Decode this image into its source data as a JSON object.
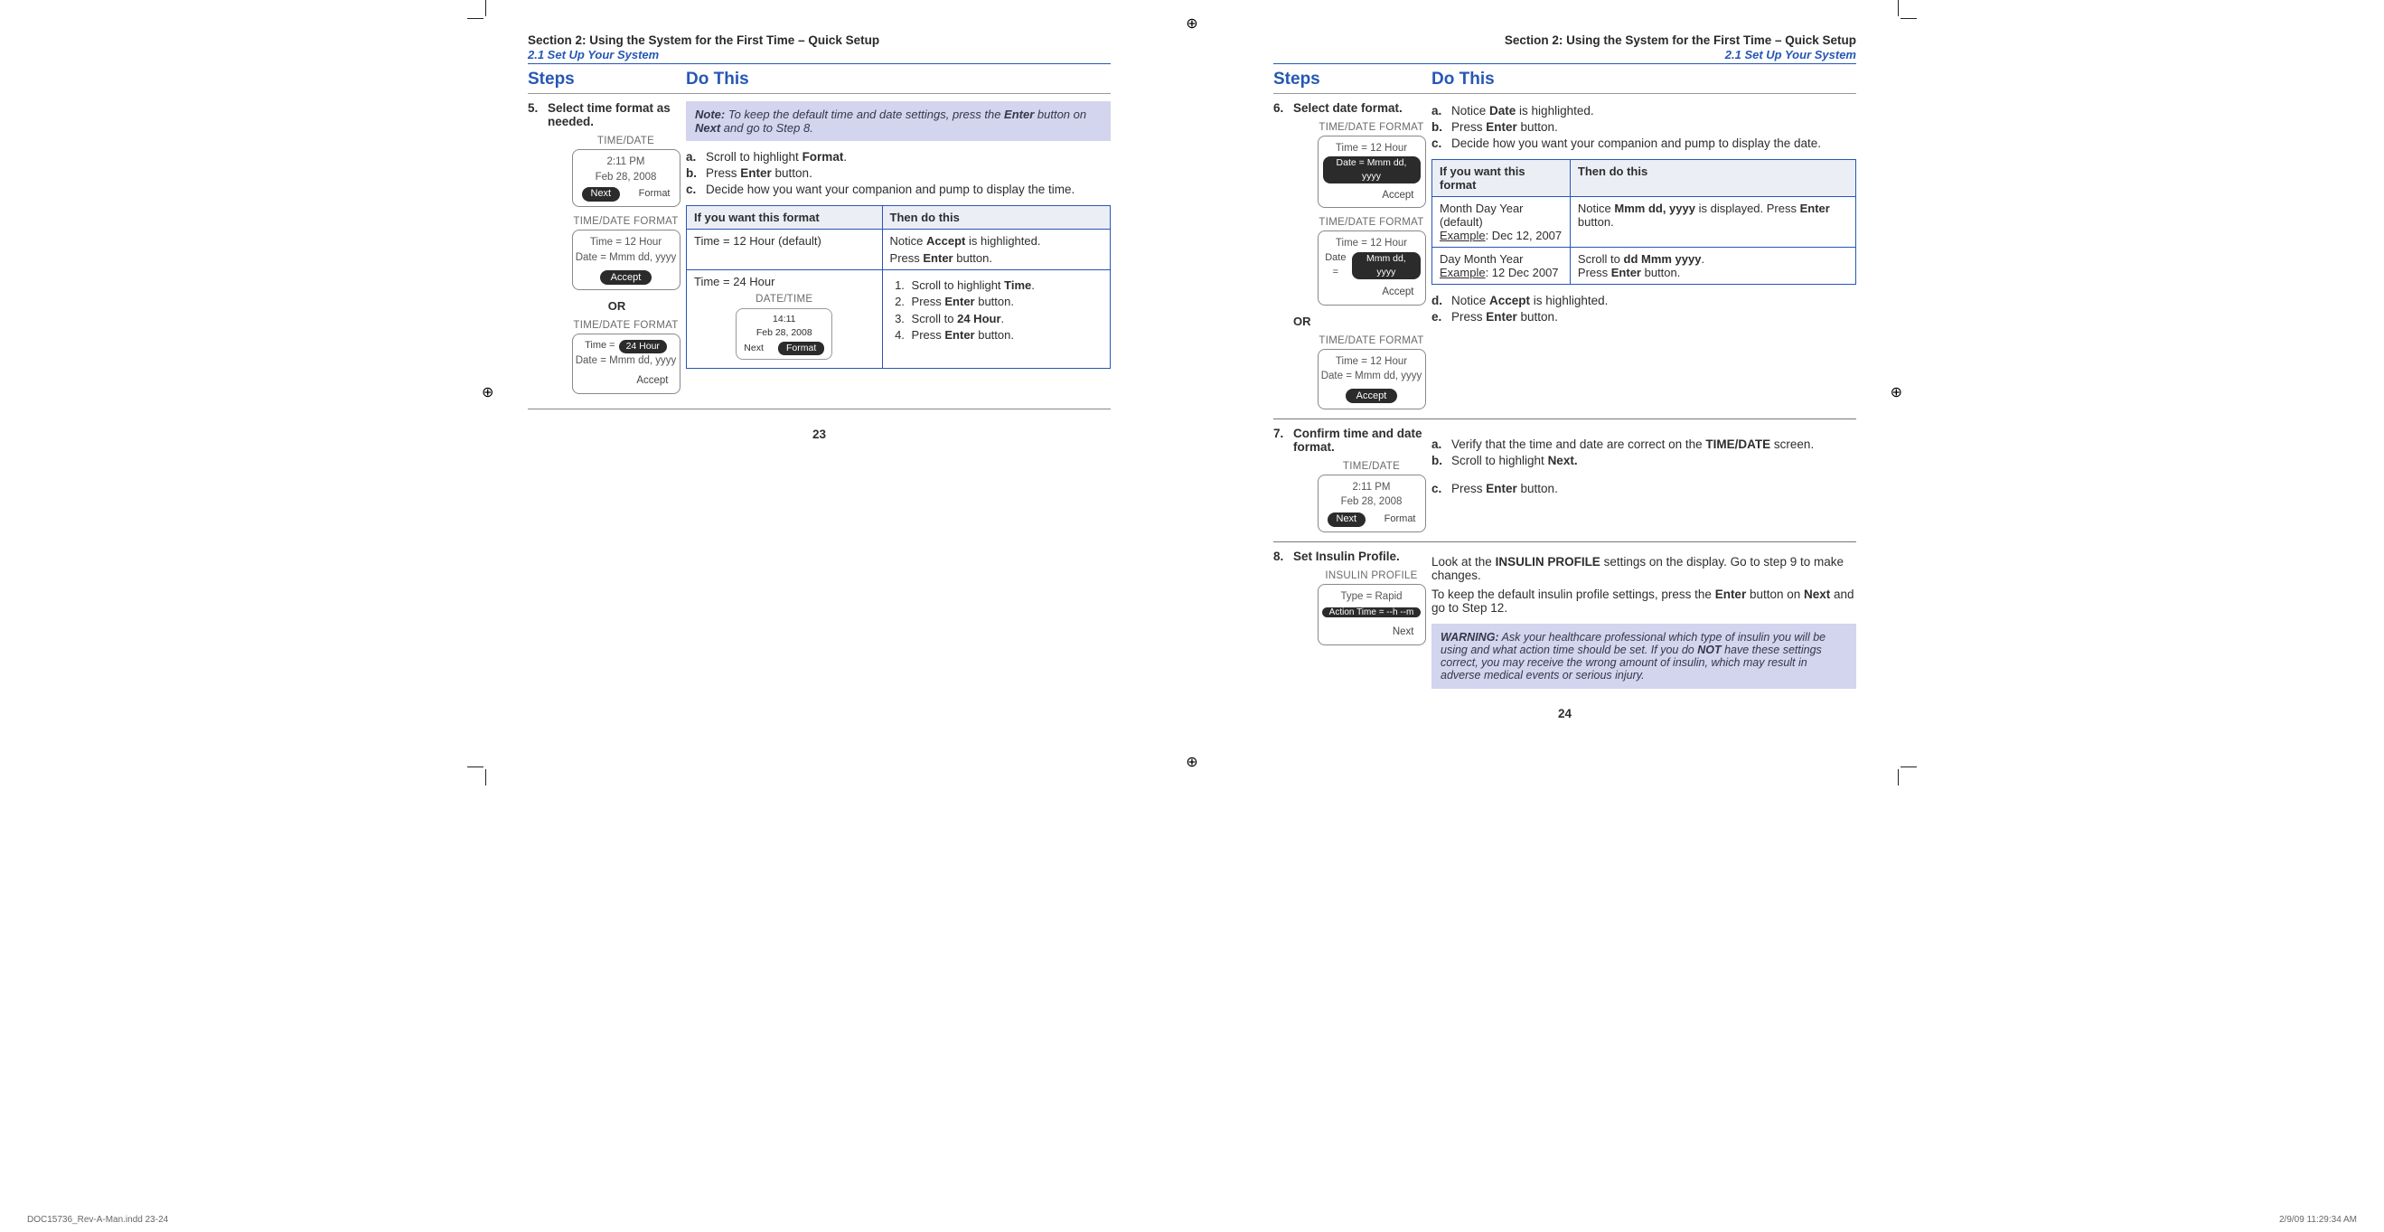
{
  "section_header": "Section 2: Using the System for the First Time – Quick Setup",
  "section_sub": "2.1 Set Up Your System",
  "col_steps": "Steps",
  "col_do": "Do This",
  "or": "OR",
  "pages": {
    "left": "23",
    "right": "24"
  },
  "footer": {
    "left": "DOC15736_Rev-A-Man.indd   23-24",
    "right": "2/9/09   11:29:34 AM"
  },
  "left": {
    "step5": {
      "num": "5.",
      "title": "Select time format as needed.",
      "screen1": {
        "title": "TIME/DATE",
        "line1": "2:11 PM",
        "line2": "Feb 28, 2008",
        "btn_sel": "Next",
        "btn": "Format"
      },
      "screen2": {
        "title": "TIME/DATE FORMAT",
        "line1": "Time = 12 Hour",
        "line2": "Date = Mmm dd, yyyy",
        "accept": "Accept"
      },
      "screen3": {
        "title": "TIME/DATE FORMAT",
        "time_lhs": "Time =",
        "time_pill": "24 Hour",
        "line2": "Date = Mmm dd, yyyy",
        "accept": "Accept"
      },
      "note": {
        "label": "Note:",
        "t1": " To keep the default time and date settings, press the ",
        "b1": "Enter",
        "t2": " button on ",
        "b2": "Next",
        "t3": " and go to Step 8."
      },
      "a": {
        "lt": "a.",
        "t1": "Scroll to highlight ",
        "b": "Format",
        "t2": "."
      },
      "b": {
        "lt": "b.",
        "t1": "Press ",
        "bold": "Enter",
        "t2": " button."
      },
      "c": {
        "lt": "c.",
        "txt": "Decide how you want your companion and pump to display the time."
      },
      "table": {
        "h1": "If you want this format",
        "h2": "Then do this",
        "r1c1": "Time = 12 Hour (default)",
        "r1c2a": "Notice ",
        "r1c2b": "Accept",
        "r1c2c": " is highlighted.",
        "r1c2d": "Press ",
        "r1c2e": "Enter",
        "r1c2f": " button.",
        "r2c1": "Time = 24 Hour",
        "dt_title": "DATE/TIME",
        "dt_line1": "14:11",
        "dt_line2": "Feb 28, 2008",
        "dt_next": "Next",
        "dt_format": "Format",
        "li1a": "Scroll to highlight ",
        "li1b": "Time",
        "li1c": ".",
        "li2a": "Press ",
        "li2b": "Enter",
        "li2c": " button.",
        "li3a": "Scroll to ",
        "li3b": "24 Hour",
        "li3c": ".",
        "li4a": "Press ",
        "li4b": "Enter",
        "li4c": " button."
      }
    }
  },
  "right": {
    "step6": {
      "num": "6.",
      "title": "Select date format.",
      "screen1": {
        "title": "TIME/DATE FORMAT",
        "line1": "Time = 12 Hour",
        "date_lhs": "Date =",
        "date_pill": "Mmm dd, yyyy",
        "accept": "Accept"
      },
      "screen2": {
        "title": "TIME/DATE FORMAT",
        "line1": "Time = 12 Hour",
        "date_lhs": "Date =",
        "date_pill": "Mmm dd, yyyy",
        "accept": "Accept"
      },
      "screen3": {
        "title": "TIME/DATE FORMAT",
        "line1": "Time = 12 Hour",
        "line2": "Date = Mmm dd, yyyy",
        "accept": "Accept"
      },
      "a": {
        "lt": "a.",
        "t1": "Notice ",
        "b": "Date",
        "t2": " is highlighted."
      },
      "b": {
        "lt": "b.",
        "t1": "Press ",
        "b": "Enter",
        "t2": " button."
      },
      "c": {
        "lt": "c.",
        "txt": "Decide how you want your companion and pump to display the date."
      },
      "table": {
        "h1": "If you want this format",
        "h2": "Then do this",
        "r1c1a": "Month Day Year (default)",
        "r1c1b": "Example",
        "r1c1c": ": Dec 12, 2007",
        "r1c2a": "Notice ",
        "r1c2b": "Mmm dd, yyyy",
        "r1c2c": " is displayed. Press ",
        "r1c2d": "Enter",
        "r1c2e": " button.",
        "r2c1a": "Day Month Year",
        "r2c1b": "Example",
        "r2c1c": ": 12 Dec 2007",
        "r2c2a": "Scroll to ",
        "r2c2b": "dd Mmm yyyy",
        "r2c2c": ". ",
        "r2c2d": "Press ",
        "r2c2e": "Enter",
        "r2c2f": " button."
      },
      "d": {
        "lt": "d.",
        "t1": "Notice ",
        "b": "Accept",
        "t2": " is highlighted."
      },
      "e": {
        "lt": "e.",
        "t1": "Press ",
        "b": "Enter",
        "t2": " button."
      }
    },
    "step7": {
      "num": "7.",
      "title": "Confirm time and date format.",
      "screen": {
        "title": "TIME/DATE",
        "line1": "2:11 PM",
        "line2": "Feb 28, 2008",
        "btn_sel": "Next",
        "btn": "Format"
      },
      "a": {
        "lt": "a.",
        "t1": "Verify that the time and date are correct on the ",
        "b": "TIME/DATE",
        "t2": " screen."
      },
      "b": {
        "lt": "b.",
        "t1": "Scroll to highlight ",
        "b": "Next."
      },
      "c": {
        "lt": "c.",
        "t1": "Press ",
        "b": "Enter",
        "t2": " button."
      }
    },
    "step8": {
      "num": "8.",
      "title": "Set Insulin Profile.",
      "screen": {
        "title": "INSULIN PROFILE",
        "line1": "Type = Rapid",
        "pill": "Action Time = --h --m",
        "next": "Next"
      },
      "p1a": "Look at the ",
      "p1b": "INSULIN PROFILE",
      "p1c": " settings on the display. Go to step 9 to make changes.",
      "p2a": "To keep the default insulin profile settings, press the ",
      "p2b": "Enter",
      "p2c": " button on ",
      "p2d": "Next",
      "p2e": " and go to Step 12.",
      "warn": {
        "label": "WARNING:",
        "t1": " Ask your healthcare professional which type of insulin you will be using and what action time should be set. If you do ",
        "b": "NOT",
        "t2": " have these settings correct, you may receive the wrong amount of insulin, which may result in adverse medical events or serious injury."
      }
    }
  }
}
